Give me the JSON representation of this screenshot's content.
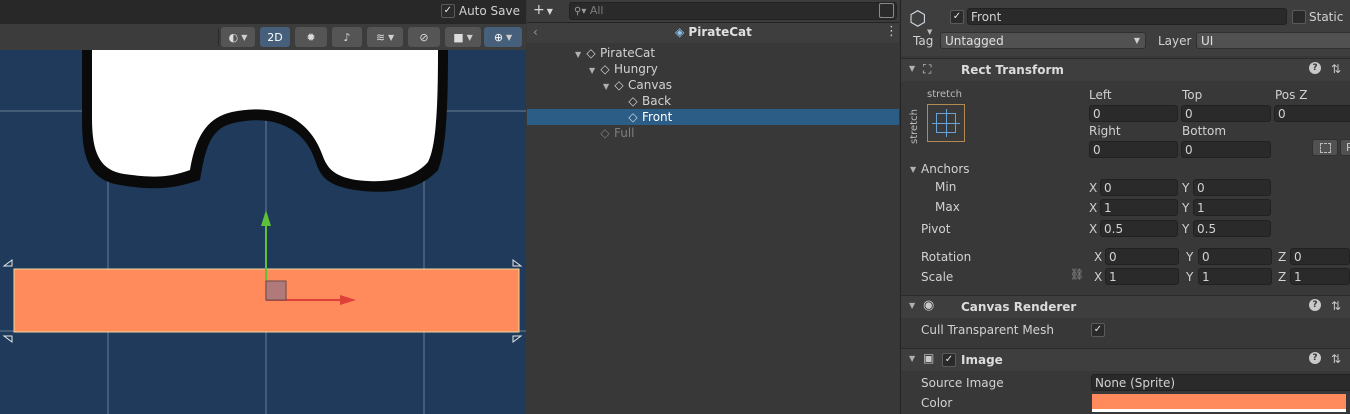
{
  "colors": {
    "scene_bg": "#1f3a5a",
    "accent": "#2c5d87",
    "image_color": "#ff8a5b",
    "cat_fill": "#ffffff",
    "outline": "#0a0a0a"
  },
  "scene": {
    "auto_save_label": "Auto Save",
    "auto_save_checked": true,
    "toolbar": {
      "shading_icon": "circle-half-icon",
      "mode_2d": "2D",
      "lighting_icon": "bulb-icon",
      "audio_icon": "audio-mute-icon",
      "effects_icon": "layers-icon",
      "visibility_icon": "eye-crossed-icon",
      "camera_icon": "camera-icon",
      "gizmos_icon": "gizmo-globe-icon"
    }
  },
  "hierarchy": {
    "add_icon": "plus-icon",
    "search_placeholder": "All",
    "scene_name": "PirateCat",
    "items": [
      {
        "label": "PirateCat",
        "depth": 0,
        "expanded": true,
        "selected": false,
        "inactive": false
      },
      {
        "label": "Hungry",
        "depth": 1,
        "expanded": true,
        "selected": false,
        "inactive": false
      },
      {
        "label": "Canvas",
        "depth": 2,
        "expanded": true,
        "selected": false,
        "inactive": false
      },
      {
        "label": "Back",
        "depth": 3,
        "expanded": false,
        "selected": false,
        "inactive": false
      },
      {
        "label": "Front",
        "depth": 3,
        "expanded": false,
        "selected": true,
        "inactive": false
      },
      {
        "label": "Full",
        "depth": 1,
        "expanded": false,
        "selected": false,
        "inactive": true
      }
    ]
  },
  "inspector": {
    "object_name": "Front",
    "active": true,
    "static_label": "Static",
    "tag_label": "Tag",
    "tag_value": "Untagged",
    "layer_label": "Layer",
    "layer_value": "UI",
    "rect_transform": {
      "title": "Rect Transform",
      "anchor_preset_top": "stretch",
      "anchor_preset_side": "stretch",
      "left_label": "Left",
      "left_value": "0",
      "top_label": "Top",
      "top_value": "0",
      "posz_label": "Pos Z",
      "posz_value": "0",
      "right_label": "Right",
      "right_value": "0",
      "bottom_label": "Bottom",
      "bottom_value": "0",
      "anchors_label": "Anchors",
      "min_label": "Min",
      "min_x": "0",
      "min_y": "0",
      "max_label": "Max",
      "max_x": "1",
      "max_y": "1",
      "pivot_label": "Pivot",
      "pivot_x": "0.5",
      "pivot_y": "0.5",
      "rotation_label": "Rotation",
      "rot_x": "0",
      "rot_y": "0",
      "rot_z": "0",
      "scale_label": "Scale",
      "scale_x": "1",
      "scale_y": "1",
      "scale_z": "1",
      "x": "X",
      "y": "Y",
      "z": "Z",
      "r": "R"
    },
    "canvas_renderer": {
      "title": "Canvas Renderer",
      "cull_label": "Cull Transparent Mesh",
      "cull_checked": true
    },
    "image": {
      "title": "Image",
      "source_label": "Source Image",
      "source_value": "None (Sprite)",
      "color_label": "Color"
    }
  }
}
